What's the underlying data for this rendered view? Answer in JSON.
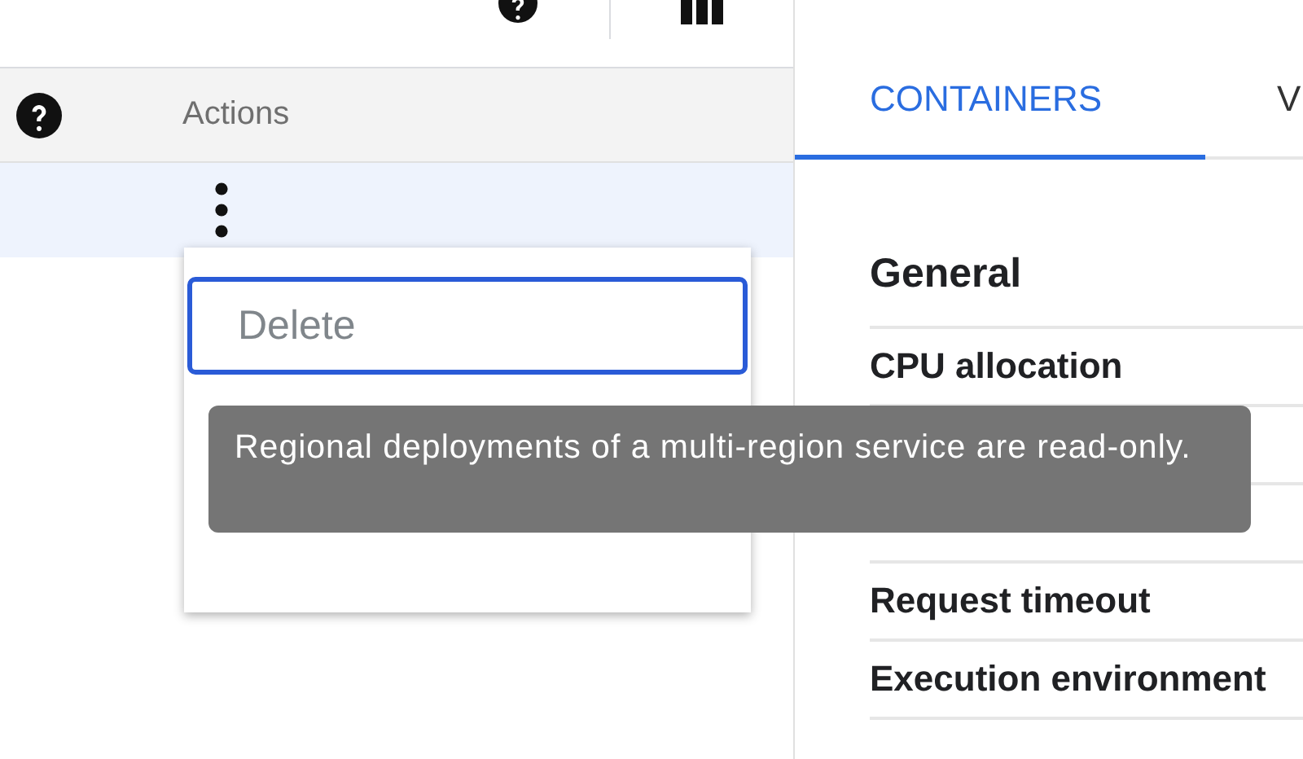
{
  "table": {
    "header": {
      "label": "Actions"
    },
    "rows": [
      {
        "selected": true
      }
    ]
  },
  "menu": {
    "items": [
      {
        "label": "Delete",
        "focused": true,
        "disabled": true
      }
    ]
  },
  "tooltip": {
    "text": "Regional deployments of a multi-region service are read-only."
  },
  "tabs": [
    {
      "label": "CONTAINERS",
      "selected": true
    },
    {
      "label": "V",
      "selected": false
    }
  ],
  "section": {
    "title": "General",
    "rows": [
      "CPU allocation",
      "Request timeout",
      "Execution environment"
    ]
  }
}
